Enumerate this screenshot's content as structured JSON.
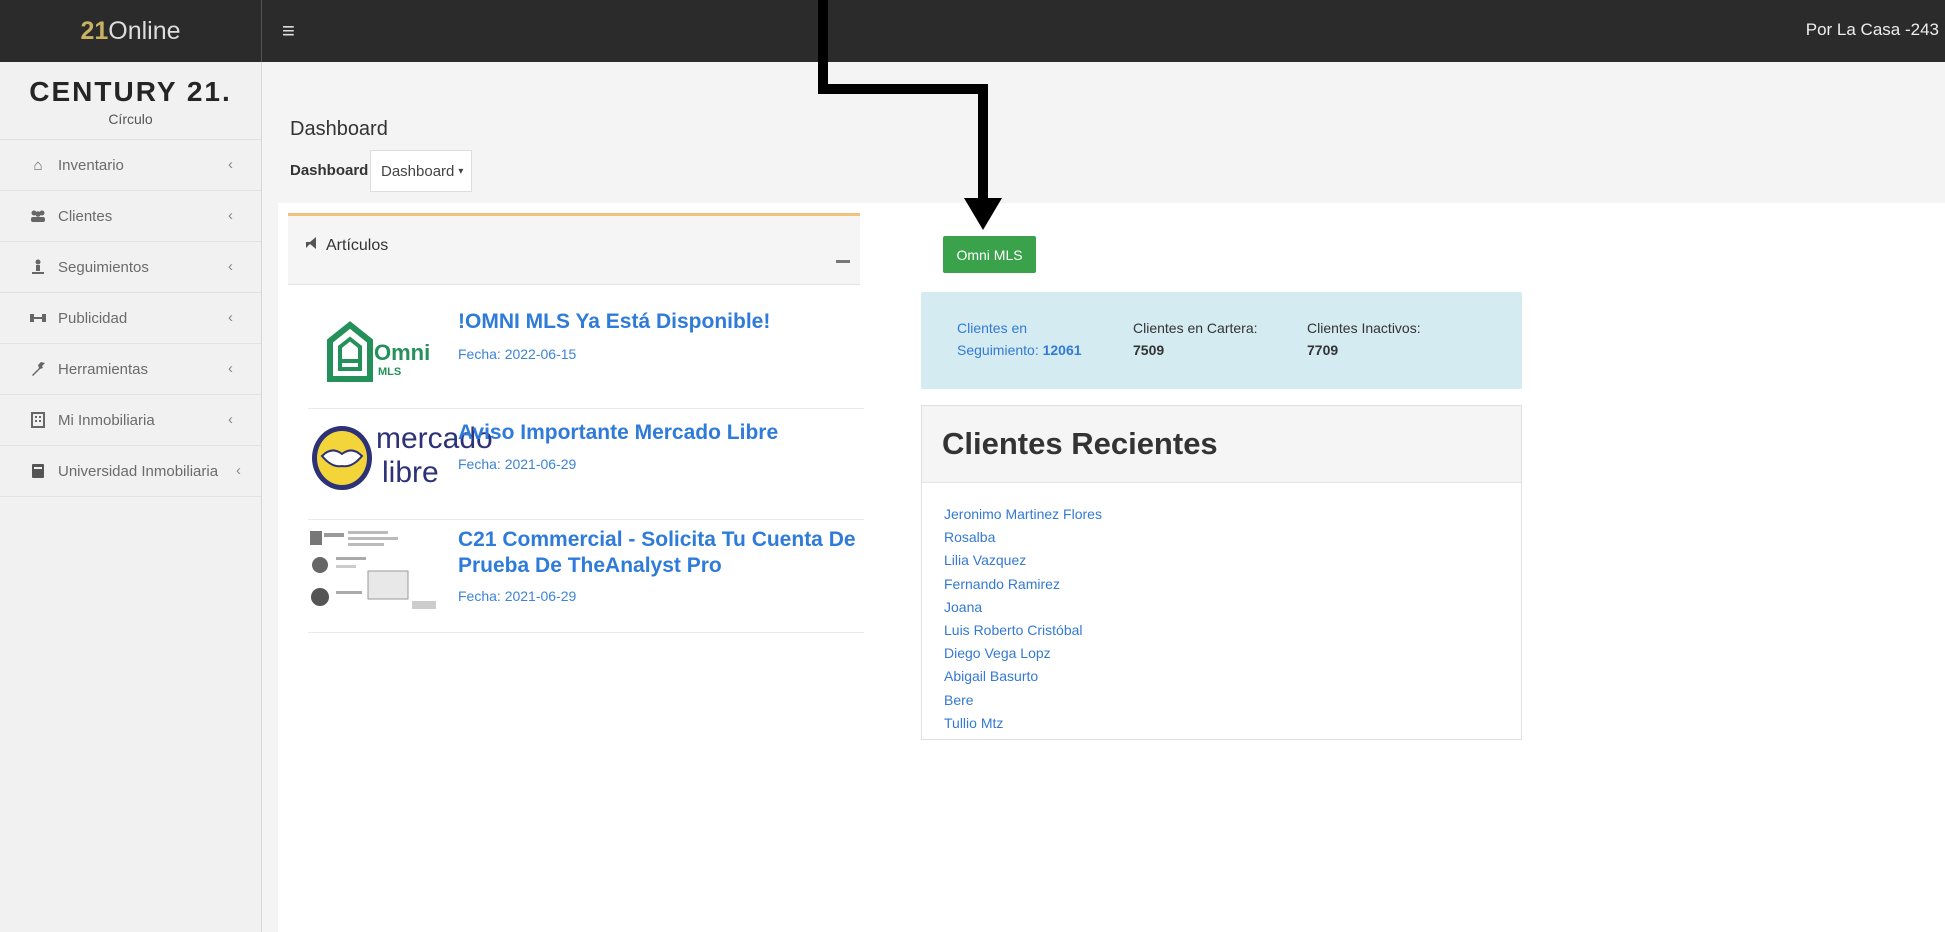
{
  "topbar": {
    "brand_num": "21",
    "brand_text": "Online",
    "menu_icon": "hamburger-icon",
    "user": "Por La Casa -243"
  },
  "sidebar": {
    "logo_main": "CENTURY 21.",
    "logo_sub": "Círculo",
    "items": [
      {
        "label": "Inventario",
        "icon": "home-icon"
      },
      {
        "label": "Clientes",
        "icon": "users-icon"
      },
      {
        "label": "Seguimientos",
        "icon": "person-tracking-icon"
      },
      {
        "label": "Publicidad",
        "icon": "bullhorn-icon"
      },
      {
        "label": "Herramientas",
        "icon": "wrench-icon"
      },
      {
        "label": "Mi Inmobiliaria",
        "icon": "building-icon"
      },
      {
        "label": "Universidad Inmobiliaria",
        "icon": "book-icon"
      }
    ]
  },
  "main": {
    "page_title": "Dashboard",
    "dashboard_label": "Dashboard :",
    "dashboard_select": "Dashboard",
    "articles": {
      "title": "Artículos",
      "items": [
        {
          "title": "!OMNI MLS Ya Está Disponible!",
          "date": "Fecha: 2022-06-15",
          "thumb": "omni-mls-logo",
          "thumb_word": "Omni",
          "thumb_sub": "MLS"
        },
        {
          "title": "Aviso Importante Mercado Libre",
          "date": "Fecha: 2021-06-29",
          "thumb": "mercado-libre-logo",
          "thumb_word": "mercado",
          "thumb_sub": "libre"
        },
        {
          "title": "C21 Commercial - Solicita Tu Cuenta De Prueba De TheAnalyst Pro",
          "date": "Fecha: 2021-06-29",
          "thumb": "theanalyst-pro-thumbnail"
        }
      ]
    },
    "omni_button": "Omni MLS",
    "stats": {
      "seguimiento_label_1": "Clientes en",
      "seguimiento_label_2": "Seguimiento:",
      "seguimiento_value": "12061",
      "cartera_label": "Clientes en Cartera:",
      "cartera_value": "7509",
      "inactivos_label": "Clientes Inactivos:",
      "inactivos_value": "7709"
    },
    "recent": {
      "title": "Clientes Recientes",
      "clients": [
        "Jeronimo Martinez Flores",
        "Rosalba",
        "Lilia Vazquez",
        "Fernando Ramirez",
        "Joana",
        "Luis Roberto Cristóbal",
        "Diego Vega Lopz",
        "Abigail Basurto",
        "Bere",
        "Tullio Mtz"
      ]
    }
  },
  "colors": {
    "topbar": "#2b2b2b",
    "accent_gold": "#c9b164",
    "link_blue": "#2f7bd9",
    "button_green": "#3aa24b",
    "stats_bg": "#d4ebf2"
  }
}
